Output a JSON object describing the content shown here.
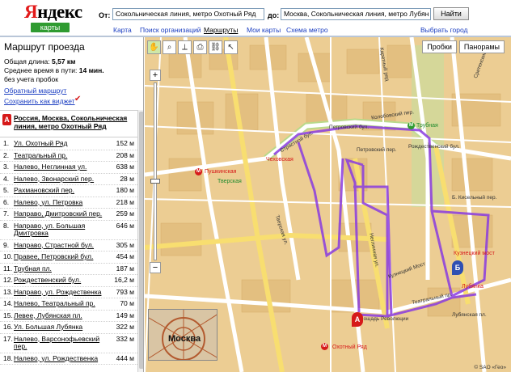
{
  "header": {
    "logo_text": "Яндекс",
    "logo_badge": "карты",
    "from_label": "От:",
    "from_value": "Сокольническая линия, метро Охотный Ряд",
    "to_label": "до:",
    "to_value": "Москва, Сокольническая линия, метро Лубян",
    "find_button": "Найти"
  },
  "nav": {
    "items": [
      "Карта",
      "Поиск организаций",
      "Маршруты",
      "Мои карты",
      "Схема метро"
    ],
    "active": "Маршруты",
    "right_link": "Выбрать город"
  },
  "panel": {
    "title": "Маршрут проезда",
    "total_length_label": "Общая длина:",
    "total_length_value": "5,57 км",
    "avg_time_label": "Среднее время в пути:",
    "avg_time_value": "14 мин.",
    "traffic_note": "без учета пробок",
    "reverse_link": "Обратный маршрут",
    "widget_link": "Сохранить как виджет",
    "start_marker": "А",
    "start_text": "Россия, Москва, Сокольническая линия, метро Охотный Ряд",
    "steps": [
      {
        "n": "1.",
        "text": "Ул. Охотный Ряд",
        "dist": "152 м"
      },
      {
        "n": "2.",
        "text": "Театральный пр.",
        "dist": "208 м"
      },
      {
        "n": "3.",
        "text": "Налево, Неглинная ул.",
        "dist": "638 м"
      },
      {
        "n": "4.",
        "text": "Налево, Звонарский пер.",
        "dist": "28 м"
      },
      {
        "n": "5.",
        "text": "Рахмановский пер.",
        "dist": "180 м"
      },
      {
        "n": "6.",
        "text": "Налево, ул. Петровка",
        "dist": "218 м"
      },
      {
        "n": "7.",
        "text": "Направо, Дмитровский пер.",
        "dist": "259 м"
      },
      {
        "n": "8.",
        "text": "Направо, ул. Большая Дмитровка",
        "dist": "646 м"
      },
      {
        "n": "9.",
        "text": "Направо, Страстной бул.",
        "dist": "305 м"
      },
      {
        "n": "10.",
        "text": "Правее, Петровский бул.",
        "dist": "454 м"
      },
      {
        "n": "11.",
        "text": "Трубная пл.",
        "dist": "187 м"
      },
      {
        "n": "12.",
        "text": "Рождественский бул.",
        "dist": "16,2 м"
      },
      {
        "n": "13.",
        "text": "Направо, ул. Рождественка",
        "dist": "793 м"
      },
      {
        "n": "14.",
        "text": "Налево, Театральный пр.",
        "dist": "70 м"
      },
      {
        "n": "15.",
        "text": "Левее, Лубянская пл.",
        "dist": "149 м"
      },
      {
        "n": "16.",
        "text": "Ул. Большая Лубянка",
        "dist": "322 м"
      },
      {
        "n": "17.",
        "text": "Налево, Варсонофьевский пер.",
        "dist": "332 м"
      },
      {
        "n": "18.",
        "text": "Налево, ул. Рождественка",
        "dist": "444 м"
      }
    ]
  },
  "map": {
    "traffic_button": "Пробки",
    "panorama_button": "Панорамы",
    "minimap_label": "Москва",
    "copyright": "© SAO «Гео»",
    "streets": [
      "Петровский пер.",
      "Страстной бул.",
      "Петровский бул.",
      "Рождественский бул.",
      "Сретенский бул.",
      "Тверская ул.",
      "Кузнецкий Мост",
      "Театральный пр.",
      "Пушкинская",
      "Чеховская",
      "Тверская",
      "Трубная",
      "Кузнецкий мост",
      "Лубянка",
      "Охотный Ряд",
      "Площадь Революции",
      "Лубянская пл.",
      "Неглинная ул.",
      "Б. Кисельный пер.",
      "Колобовский пер.",
      "Каретный ряд"
    ],
    "route_color": "#8a3ce0",
    "markers": {
      "start": "А",
      "end": "Б"
    }
  }
}
